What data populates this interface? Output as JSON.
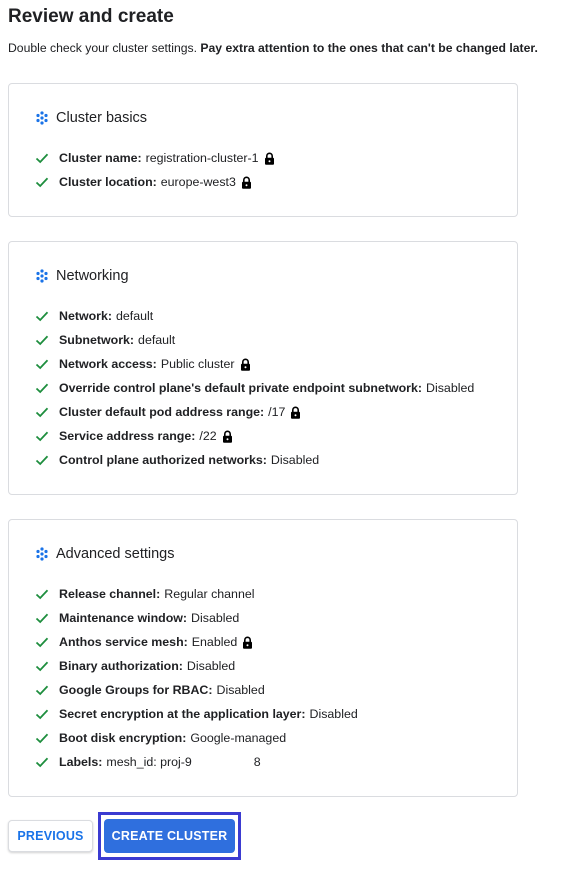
{
  "page": {
    "title": "Review and create",
    "subtitle_regular": "Double check your cluster settings.",
    "subtitle_bold": "Pay extra attention to the ones that can't be changed later."
  },
  "sections": [
    {
      "title": "Cluster basics",
      "items": [
        {
          "label": "Cluster name:",
          "value": "registration-cluster-1",
          "locked": true
        },
        {
          "label": "Cluster location:",
          "value": "europe-west3",
          "locked": true
        }
      ]
    },
    {
      "title": "Networking",
      "items": [
        {
          "label": "Network:",
          "value": "default",
          "locked": false
        },
        {
          "label": "Subnetwork:",
          "value": "default",
          "locked": false
        },
        {
          "label": "Network access:",
          "value": "Public cluster",
          "locked": true
        },
        {
          "label": "Override control plane's default private endpoint subnetwork:",
          "value": "Disabled",
          "locked": false
        },
        {
          "label": "Cluster default pod address range:",
          "value": "/17",
          "locked": true
        },
        {
          "label": "Service address range:",
          "value": "/22",
          "locked": true
        },
        {
          "label": "Control plane authorized networks:",
          "value": "Disabled",
          "locked": false
        }
      ]
    },
    {
      "title": "Advanced settings",
      "items": [
        {
          "label": "Release channel:",
          "value": "Regular channel",
          "locked": false
        },
        {
          "label": "Maintenance window:",
          "value": "Disabled",
          "locked": false
        },
        {
          "label": "Anthos service mesh:",
          "value": "Enabled",
          "locked": true
        },
        {
          "label": "Binary authorization:",
          "value": "Disabled",
          "locked": false
        },
        {
          "label": "Google Groups for RBAC:",
          "value": "Disabled",
          "locked": false
        },
        {
          "label": "Secret encryption at the application layer:",
          "value": "Disabled",
          "locked": false
        },
        {
          "label": "Boot disk encryption:",
          "value": "Google-managed",
          "locked": false
        },
        {
          "label": "Labels:",
          "value": "mesh_id: proj-9",
          "value_suffix": "8",
          "locked": false
        }
      ]
    }
  ],
  "buttons": {
    "previous": "PREVIOUS",
    "create": "CREATE CLUSTER"
  },
  "colors": {
    "check": "#1e8e3e",
    "section_icon": "#1a73e8",
    "primary_button": "#2f6fde",
    "focus_ring": "#3b3bd1"
  },
  "icons": {
    "section": "cluster-dots-icon",
    "item": "check-icon",
    "immutable": "lock-icon"
  }
}
